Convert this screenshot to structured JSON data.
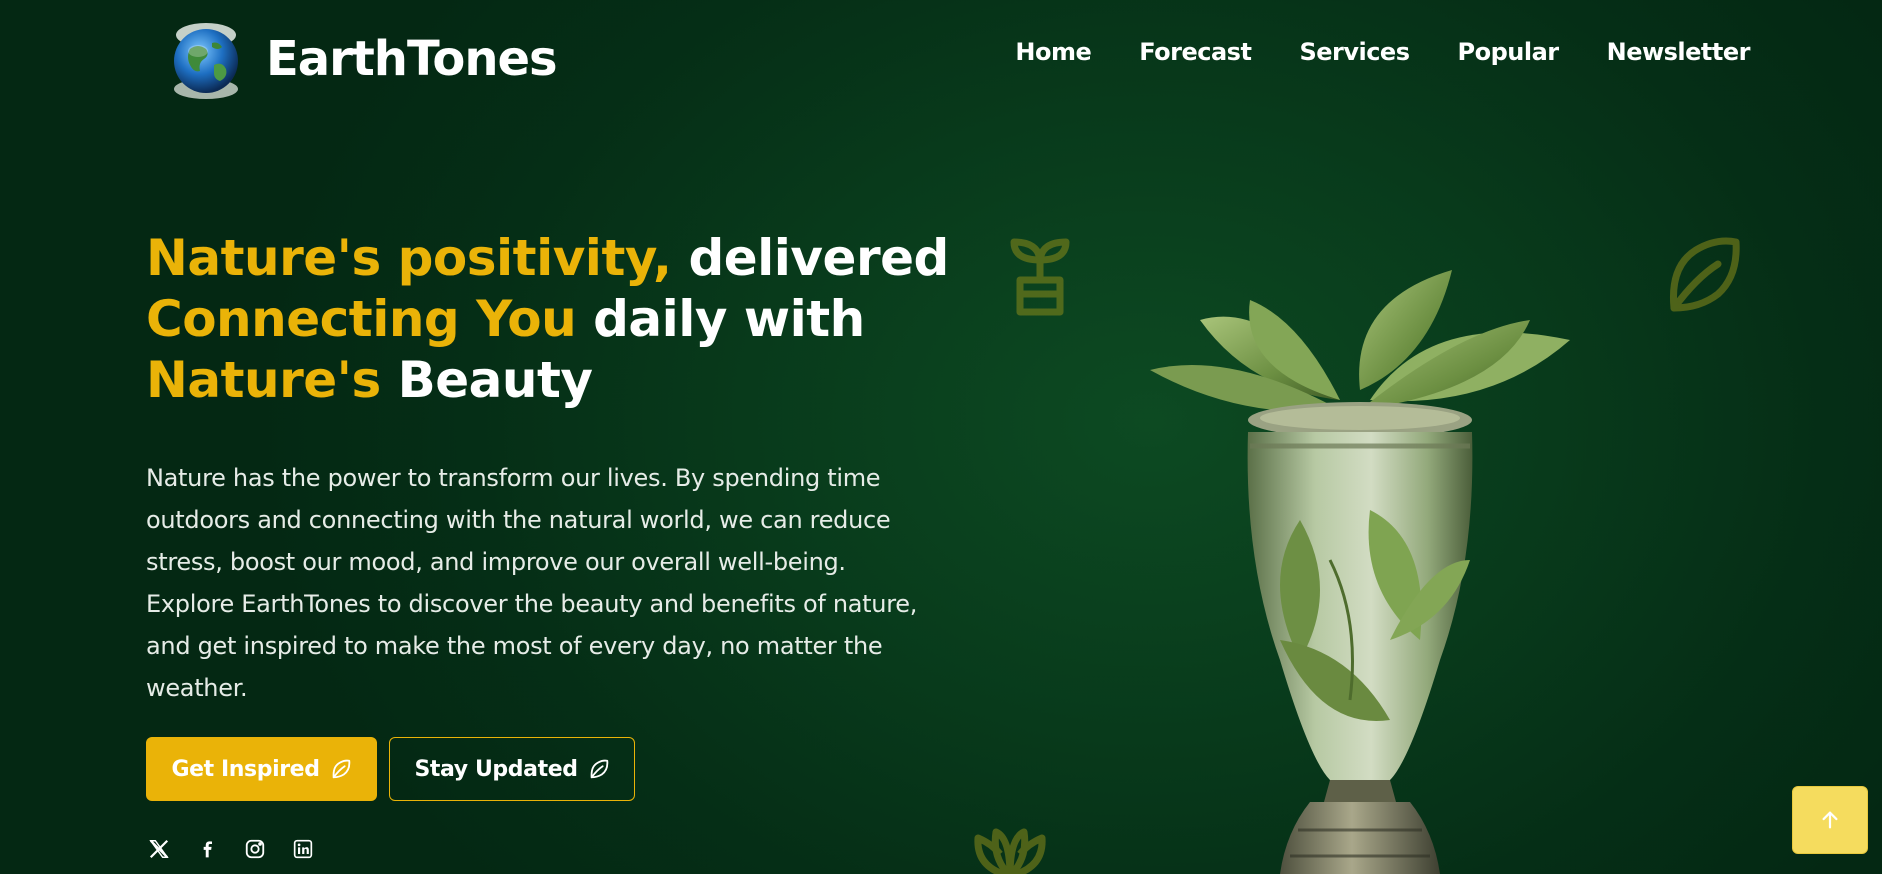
{
  "brand": {
    "name": "EarthTones",
    "logo_icon": "globe-icon"
  },
  "nav": {
    "items": [
      {
        "label": "Home"
      },
      {
        "label": "Forecast"
      },
      {
        "label": "Services"
      },
      {
        "label": "Popular"
      },
      {
        "label": "Newsletter"
      }
    ]
  },
  "hero": {
    "title_line1_highlight": "Nature's positivity,",
    "title_line1_rest": " delivered",
    "title_line2_highlight": "Connecting You",
    "title_line2_rest": " daily with",
    "title_line3_highlight": "Nature's",
    "title_line3_rest": " Beauty",
    "description": "Nature has the power to transform our lives. By spending time outdoors and connecting with the natural world, we can reduce stress, boost our mood, and improve our overall well-being. Explore EarthTones to discover the beauty and benefits of nature, and get inspired to make the most of every day, no matter the weather.",
    "primary_button": "Get Inspired",
    "secondary_button": "Stay Updated"
  },
  "socials": [
    "x-icon",
    "facebook-icon",
    "instagram-icon",
    "linkedin-icon"
  ],
  "colors": {
    "accent": "#eab308",
    "background": "#052e16",
    "text": "#ffffff",
    "scroll_top_bg": "#f5dc5e"
  },
  "icons": {
    "scroll_top": "arrow-up-icon",
    "button_icon": "leaf-icon",
    "decor": [
      "plant-pot-icon",
      "leaf-icon",
      "lotus-icon"
    ]
  }
}
